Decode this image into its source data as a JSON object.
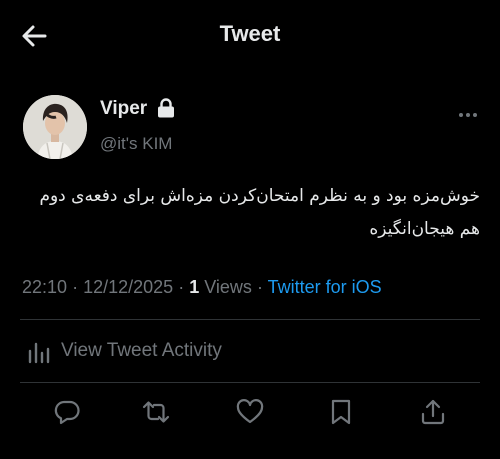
{
  "header": {
    "title": "Tweet"
  },
  "author": {
    "display_name": "Viper",
    "handle": "@it's KIM",
    "protected": true
  },
  "tweet": {
    "text": "خوش‌مزه بود و به نظرم امتحان‌کردن مزه‌اش برای دفعه‌ی دوم هم هیجان‌انگیزه",
    "time": "22:10",
    "date": "12/12/2025",
    "views_count": "1",
    "views_label": "Views",
    "client": "Twitter for iOS",
    "separator": "·"
  },
  "activity": {
    "label": "View Tweet Activity"
  },
  "actions": [
    "reply-icon",
    "retweet-icon",
    "like-icon",
    "bookmark-icon",
    "share-icon"
  ],
  "colors": {
    "background": "#000000",
    "text": "#e7e9ea",
    "muted": "#71767b",
    "link": "#1d9bf0",
    "divider": "#2f3336"
  }
}
